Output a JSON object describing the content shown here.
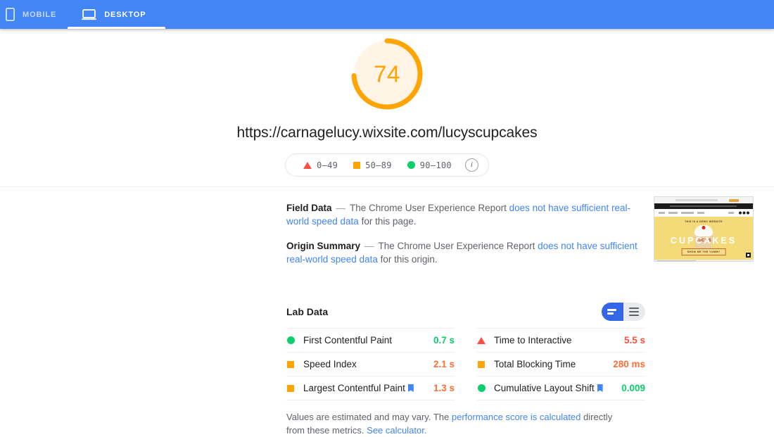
{
  "tabs": [
    {
      "id": "mobile",
      "label": "MOBILE",
      "icon": "mobile-phone-icon",
      "active": false
    },
    {
      "id": "desktop",
      "label": "DESKTOP",
      "icon": "laptop-icon",
      "active": true
    }
  ],
  "score": {
    "value": "74",
    "percent": 74,
    "color": "#ffa400",
    "track_color": "#fff4e5"
  },
  "page_url": "https://carnagelucy.wixsite.com/lucyscupcakes",
  "legend": {
    "items": [
      {
        "marker": "triangle-marker",
        "label": "0–49",
        "color": "#ff4e42"
      },
      {
        "marker": "square-marker",
        "label": "50–89",
        "color": "#ffa400"
      },
      {
        "marker": "circle-marker",
        "label": "90–100",
        "color": "#0cce6b"
      }
    ],
    "info_glyph": "i"
  },
  "field_data": {
    "title": "Field Data",
    "dash": "—",
    "text_before": "The Chrome User Experience Report",
    "link": "does not have sufficient real-world speed data",
    "text_after": "for this page."
  },
  "origin_summary": {
    "title": "Origin Summary",
    "dash": "—",
    "text_before": "The Chrome User Experience Report",
    "link": "does not have sufficient real-world speed data",
    "text_after": "for this origin."
  },
  "thumbnail": {
    "alt": "page-screenshot-thumbnail",
    "demo_banner": "THIS IS A DEMO WEBSITE",
    "logo_word": "LUCY'S",
    "headline": "CUPCAKES",
    "cta": "SHOW ME THE YUMMY"
  },
  "lab_data": {
    "title": "Lab Data",
    "view_toggle": {
      "options": [
        {
          "id": "compact-view",
          "icon": "compact-list-icon",
          "active": true
        },
        {
          "id": "detail-view",
          "icon": "detail-list-icon",
          "active": false
        }
      ]
    },
    "metrics_left": [
      {
        "status": "circle-marker",
        "status_color": "#0cce6b",
        "name": "First Contentful Paint",
        "value": "0.7 s",
        "value_class": "good",
        "flag": false
      },
      {
        "status": "square-marker",
        "status_color": "#ffa400",
        "name": "Speed Index",
        "value": "2.1 s",
        "value_class": "avg",
        "flag": false
      },
      {
        "status": "square-marker",
        "status_color": "#ffa400",
        "name": "Largest Contentful Paint",
        "value": "1.3 s",
        "value_class": "avg",
        "flag": true
      }
    ],
    "metrics_right": [
      {
        "status": "triangle-marker",
        "status_color": "#ff4e42",
        "name": "Time to Interactive",
        "value": "5.5 s",
        "value_class": "poor",
        "flag": false
      },
      {
        "status": "square-marker",
        "status_color": "#ffa400",
        "name": "Total Blocking Time",
        "value": "280 ms",
        "value_class": "avg",
        "flag": false
      },
      {
        "status": "circle-marker",
        "status_color": "#0cce6b",
        "name": "Cumulative Layout Shift",
        "value": "0.009",
        "value_class": "good",
        "flag": true
      }
    ]
  },
  "footnote": {
    "text_before": "Values are estimated and may vary. The",
    "link1": "performance score is calculated",
    "text_middle": "directly from these metrics.",
    "link2": "See calculator."
  }
}
